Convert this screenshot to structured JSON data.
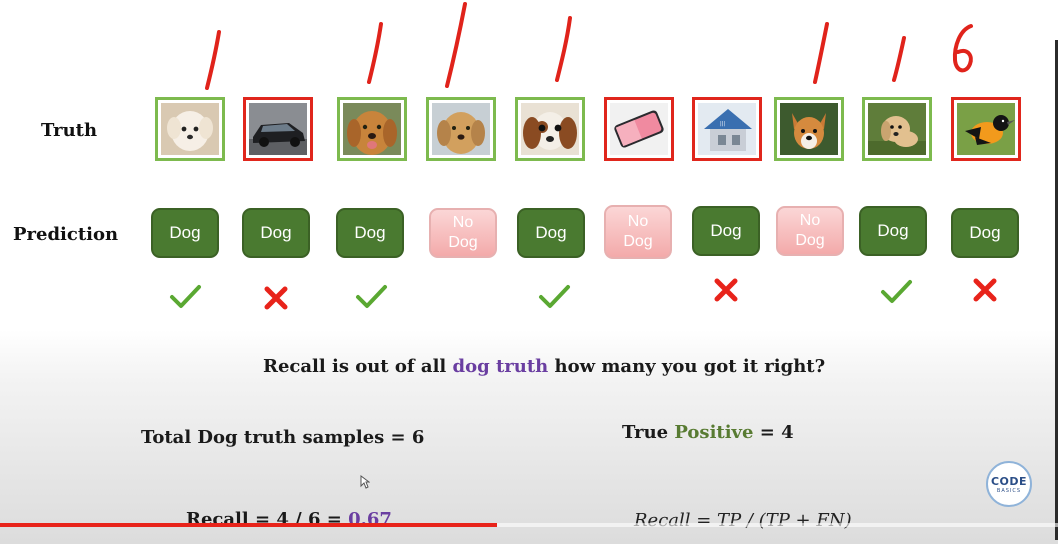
{
  "labels": {
    "truth": "Truth",
    "prediction": "Prediction"
  },
  "annotations": [
    "/",
    "/",
    "/",
    "/",
    "/",
    "/",
    "6"
  ],
  "samples": [
    {
      "truth": "dog",
      "image": "white-puppy",
      "prediction": "Dog",
      "predicted_dog": true,
      "mark": "check"
    },
    {
      "truth": "not-dog",
      "image": "car",
      "prediction": "Dog",
      "predicted_dog": true,
      "mark": "cross"
    },
    {
      "truth": "dog",
      "image": "golden-retriever",
      "prediction": "Dog",
      "predicted_dog": true,
      "mark": "check"
    },
    {
      "truth": "dog",
      "image": "golden-retriever-2",
      "prediction": "No\nDog",
      "predicted_dog": false,
      "mark": ""
    },
    {
      "truth": "dog",
      "image": "cavalier-spaniel",
      "prediction": "Dog",
      "predicted_dog": true,
      "mark": "check"
    },
    {
      "truth": "not-dog",
      "image": "phone",
      "prediction": "No\nDog",
      "predicted_dog": false,
      "mark": ""
    },
    {
      "truth": "not-dog",
      "image": "house",
      "prediction": "Dog",
      "predicted_dog": true,
      "mark": "cross"
    },
    {
      "truth": "dog",
      "image": "corgi",
      "prediction": "No\nDog",
      "predicted_dog": false,
      "mark": ""
    },
    {
      "truth": "dog",
      "image": "puppy-on-grass",
      "prediction": "Dog",
      "predicted_dog": true,
      "mark": "check"
    },
    {
      "truth": "not-dog",
      "image": "oriole-bird",
      "prediction": "Dog",
      "predicted_dog": true,
      "mark": "cross"
    }
  ],
  "question": {
    "before": "Recall is out of all ",
    "highlight": "dog truth",
    "after": " how many you got it right?"
  },
  "total": "Total Dog truth samples = 6",
  "true_positive": {
    "before": "True ",
    "highlight": "Positive",
    "after": " = 4"
  },
  "recall": {
    "before": "Recall = 4 / 6 = ",
    "value": "0.67"
  },
  "formula": "Recall = TP / (TP + FN)",
  "logo": {
    "line1": "CODE",
    "line2": "BASICS"
  },
  "video_progress": 0.47,
  "colors": {
    "dog_truth_border": "#7dba4e",
    "not_dog_border": "#e0261c",
    "dog_button": "#4a7a30",
    "nodog_button": "#f3aaaa",
    "check": "#5aa832",
    "cross": "#e8231a",
    "annotation": "#e0231b",
    "purple": "#6a3ea1",
    "green": "#587b32"
  }
}
